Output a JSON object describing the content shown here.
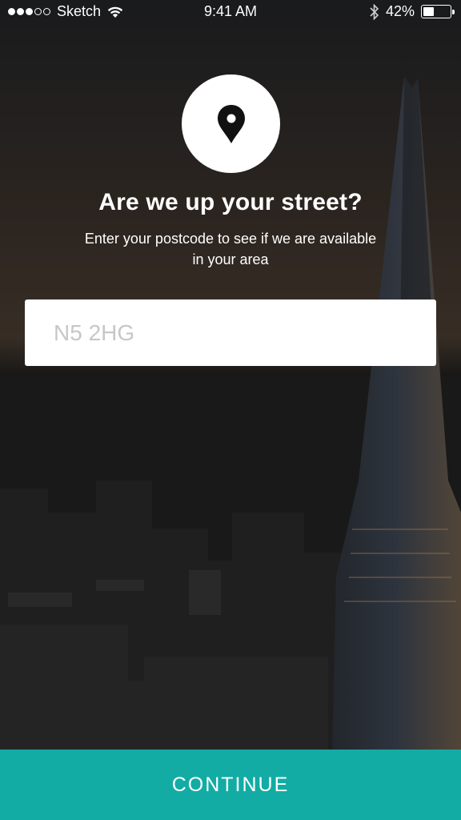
{
  "status_bar": {
    "carrier": "Sketch",
    "time": "9:41 AM",
    "battery": "42%",
    "battery_level": 0.42,
    "signal_bars_filled": 3,
    "signal_bars_total": 5
  },
  "main": {
    "icon": "map-pin-icon",
    "heading": "Are we up your street?",
    "subheading": "Enter your postcode to see if we are available in your area",
    "postcode_placeholder": "N5 2HG",
    "postcode_value": ""
  },
  "footer": {
    "continue_label": "CONTINUE"
  },
  "colors": {
    "accent": "#12aca4",
    "input_background": "#ffffff",
    "placeholder": "#c7c7c7"
  }
}
